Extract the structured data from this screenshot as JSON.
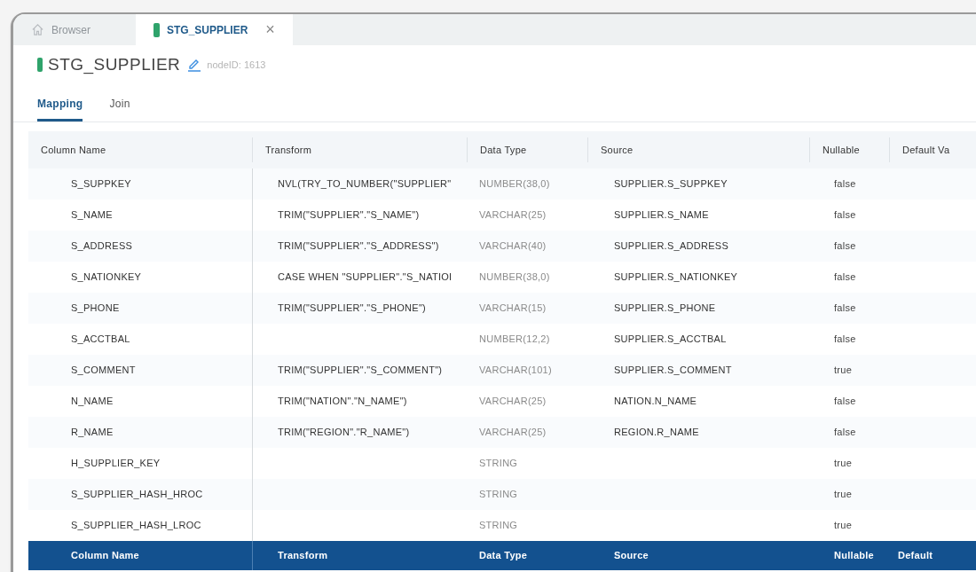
{
  "window_tabs": [
    {
      "label": "Browser",
      "kind": "home",
      "selected": false
    },
    {
      "label": "STG_SUPPLIER",
      "kind": "node",
      "selected": true,
      "close": "×"
    }
  ],
  "header": {
    "title": "STG_SUPPLIER",
    "node_id": "nodeID: 1613"
  },
  "tabs": [
    {
      "label": "Mapping",
      "selected": true
    },
    {
      "label": "Join",
      "selected": false
    }
  ],
  "table": {
    "columns": [
      "Column Name",
      "Transform",
      "Data Type",
      "Source",
      "Nullable",
      "Default Va"
    ],
    "rows": [
      [
        "S_SUPPKEY",
        "NVL(TRY_TO_NUMBER(\"SUPPLIER\"",
        "NUMBER(38,0)",
        "SUPPLIER.S_SUPPKEY",
        "false"
      ],
      [
        "S_NAME",
        "TRIM(\"SUPPLIER\".\"S_NAME\")",
        "VARCHAR(25)",
        "SUPPLIER.S_NAME",
        "false"
      ],
      [
        "S_ADDRESS",
        "TRIM(\"SUPPLIER\".\"S_ADDRESS\")",
        "VARCHAR(40)",
        "SUPPLIER.S_ADDRESS",
        "false"
      ],
      [
        "S_NATIONKEY",
        "CASE WHEN \"SUPPLIER\".\"S_NATIOI",
        "NUMBER(38,0)",
        "SUPPLIER.S_NATIONKEY",
        "false"
      ],
      [
        "S_PHONE",
        "TRIM(\"SUPPLIER\".\"S_PHONE\")",
        "VARCHAR(15)",
        "SUPPLIER.S_PHONE",
        "false"
      ],
      [
        "S_ACCTBAL",
        "",
        "NUMBER(12,2)",
        "SUPPLIER.S_ACCTBAL",
        "false"
      ],
      [
        "S_COMMENT",
        "TRIM(\"SUPPLIER\".\"S_COMMENT\")",
        "VARCHAR(101)",
        "SUPPLIER.S_COMMENT",
        "true"
      ],
      [
        "N_NAME",
        "TRIM(\"NATION\".\"N_NAME\")",
        "VARCHAR(25)",
        "NATION.N_NAME",
        "false"
      ],
      [
        "R_NAME",
        "TRIM(\"REGION\".\"R_NAME\")",
        "VARCHAR(25)",
        "REGION.R_NAME",
        "false"
      ],
      [
        "H_SUPPLIER_KEY",
        "",
        "STRING",
        "",
        "true"
      ],
      [
        "S_SUPPLIER_HASH_HROC",
        "",
        "STRING",
        "",
        "true"
      ],
      [
        "S_SUPPLIER_HASH_LROC",
        "",
        "STRING",
        "",
        "true"
      ]
    ],
    "footer_columns": [
      "Column Name",
      "Transform",
      "Data Type",
      "Source",
      "Nullable",
      "Default"
    ]
  }
}
